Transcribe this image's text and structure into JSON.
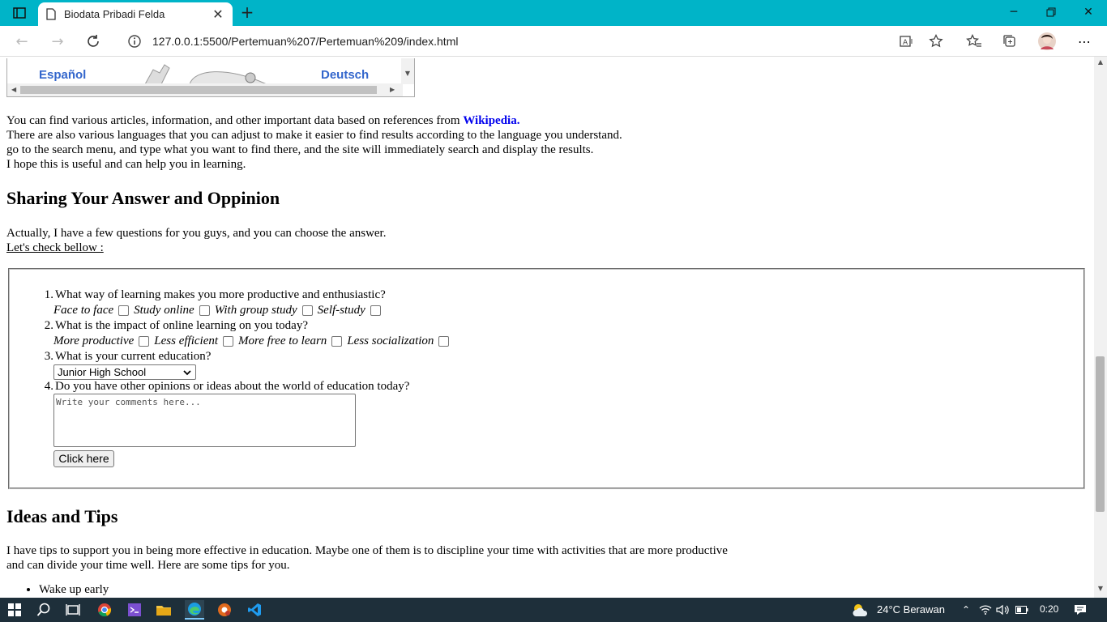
{
  "browser": {
    "tab_title": "Biodata Pribadi Felda",
    "url": "127.0.0.1:5500/Pertemuan%207/Pertemuan%209/index.html"
  },
  "iframe": {
    "lang_left": "Español",
    "lang_right": "Deutsch"
  },
  "intro": {
    "line1_prefix": "You can find various articles, information, and other important data based on references from ",
    "line1_link": "Wikipedia.",
    "line2": "There are also various languages that you can adjust to make it easier to find results according to the language you understand.",
    "line3": "go to the search menu, and type what you want to find there, and the site will immediately search and display the results.",
    "line4": "I hope this is useful and can help you in learning."
  },
  "sharing": {
    "heading": "Sharing Your Answer and Oppinion",
    "text1": "Actually, I have a few questions for you guys, and you can choose the answer.",
    "text2": "Let's check bellow :"
  },
  "quiz": {
    "q1": {
      "num": "1.",
      "text": "What way of learning makes you more productive and enthusiastic?",
      "options": [
        "Face to face",
        "Study online",
        "With group study",
        "Self-study"
      ]
    },
    "q2": {
      "num": "2.",
      "text": "What is the impact of online learning on you today?",
      "options": [
        "More productive",
        "Less efficient",
        "More free to learn",
        "Less socialization"
      ]
    },
    "q3": {
      "num": "3.",
      "text": "What is your current education?",
      "selected": "Junior High School"
    },
    "q4": {
      "num": "4.",
      "text": "Do you have other opinions or ideas about the world of education today?",
      "placeholder": "Write your comments here..."
    },
    "button": "Click here"
  },
  "ideas": {
    "heading": "Ideas and Tips",
    "line1": "I have tips to support you in being more effective in education. Maybe one of them is to discipline your time with activities that are more productive",
    "line2": "and can divide your time well. Here are some tips for you.",
    "tips": [
      "Wake up early"
    ]
  },
  "taskbar": {
    "weather": "24°C  Berawan",
    "time": "0:20"
  },
  "colors": {
    "titlebar": "#00b4c8",
    "link": "#0000ee",
    "wiki_lang": "#3366cc",
    "taskbar": "#1e2f3a"
  }
}
